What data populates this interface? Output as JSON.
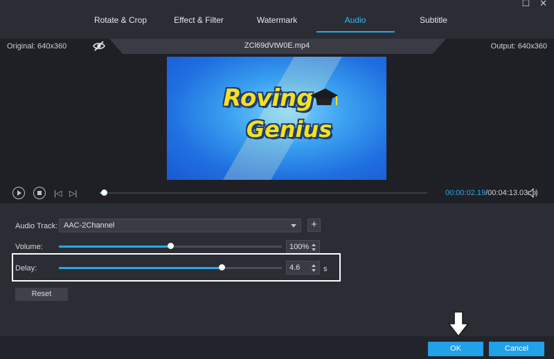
{
  "window": {
    "maximize_glyph": "☐",
    "close_glyph": "✕"
  },
  "tabs": [
    {
      "label": "Rotate & Crop",
      "active": false
    },
    {
      "label": "Effect & Filter",
      "active": false
    },
    {
      "label": "Watermark",
      "active": false
    },
    {
      "label": "Audio",
      "active": true
    },
    {
      "label": "Subtitle",
      "active": false
    }
  ],
  "info": {
    "original": "Original: 640x360",
    "filename": "ZCl69dVtW0E.mp4",
    "output": "Output: 640x360",
    "eye_icon": "eye-slash-icon"
  },
  "video": {
    "line1": "Roving",
    "line2": "Genius"
  },
  "playback": {
    "current_time": "00:00:02.19",
    "total_time": "/00:04:13.03",
    "progress": 0.013
  },
  "audio": {
    "track_label": "Audio Track:",
    "track_value": "AAC-2Channel",
    "add_glyph": "+",
    "volume_label": "Volume:",
    "volume_value": "100%",
    "volume_fraction": 0.5,
    "delay_label": "Delay:",
    "delay_value": "4.6",
    "delay_fraction": 0.73,
    "delay_unit": "s",
    "reset_label": "Reset"
  },
  "footer": {
    "ok_label": "OK",
    "cancel_label": "Cancel"
  },
  "colors": {
    "accent": "#2aa8ec",
    "background": "#2b2d35",
    "dark": "#1f2026"
  }
}
